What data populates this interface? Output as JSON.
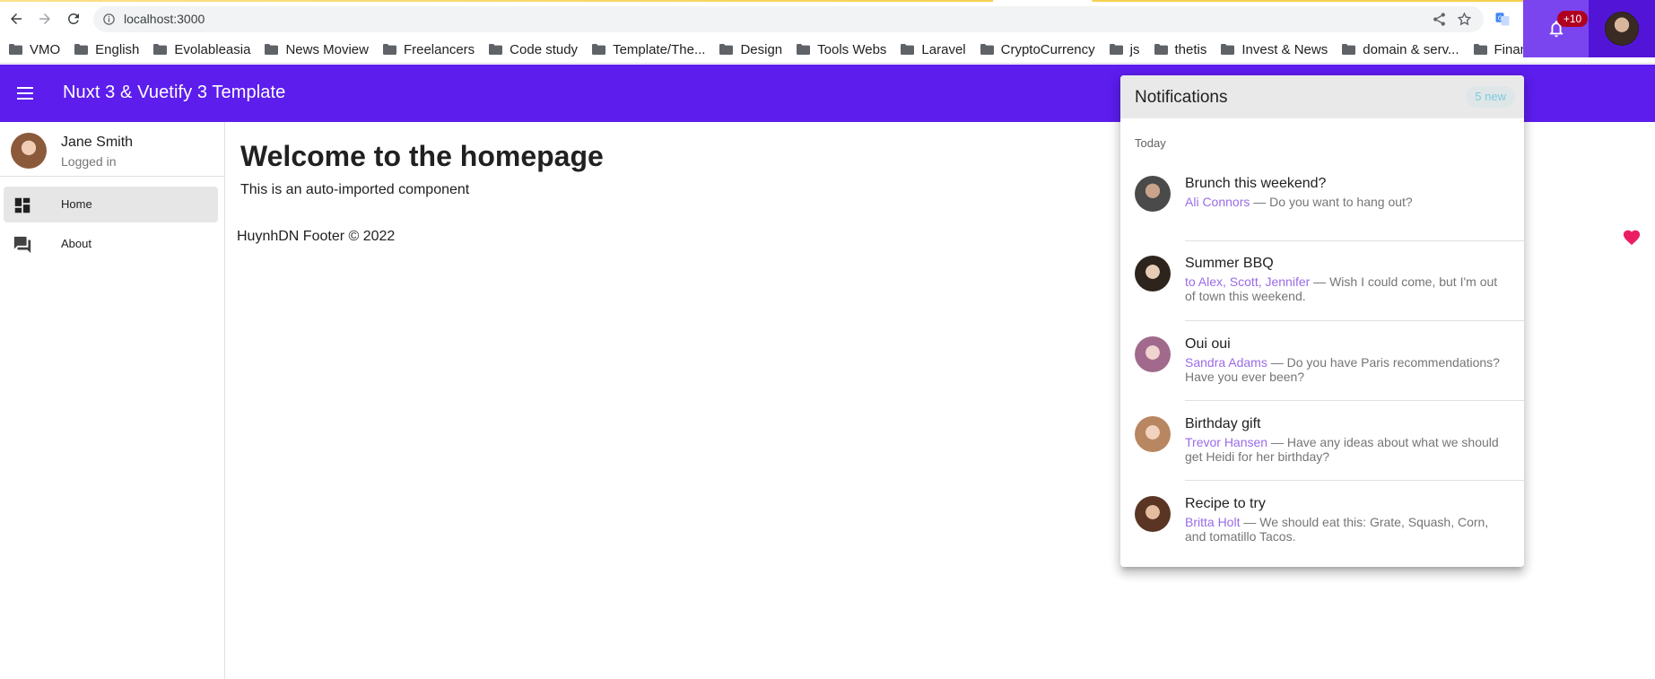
{
  "browser": {
    "url": "localhost:3000",
    "bookmarks": [
      "VMO",
      "English",
      "Evolableasia",
      "News Moview",
      "Freelancers",
      "Code study",
      "Template/The...",
      "Design",
      "Tools Webs",
      "Laravel",
      "CryptoCurrency",
      "js",
      "thetis",
      "Invest & News",
      "domain & serv...",
      "Financial"
    ],
    "bookmarks_more": "»"
  },
  "appbar": {
    "title": "Nuxt 3 & Vuetify 3 Template",
    "notification_badge": "+10"
  },
  "drawer": {
    "user_name": "Jane Smith",
    "user_status": "Logged in",
    "items": [
      {
        "label": "Home",
        "icon": "dashboard-icon",
        "active": true
      },
      {
        "label": "About",
        "icon": "forum-icon",
        "active": false
      }
    ]
  },
  "main": {
    "heading": "Welcome to the homepage",
    "subtext": "This is an auto-imported component",
    "footer": "HuynhDN Footer © 2022"
  },
  "notifications": {
    "title": "Notifications",
    "chip": "5 new",
    "subheader": "Today",
    "items": [
      {
        "title": "Brunch this weekend?",
        "from": "Ali Connors",
        "text": " — Do you want to hang out?"
      },
      {
        "title": "Summer BBQ",
        "from": "to Alex, Scott, Jennifer",
        "text": " — Wish I could come, but I'm out of town this weekend."
      },
      {
        "title": "Oui oui",
        "from": "Sandra Adams",
        "text": " — Do you have Paris recommendations? Have you ever been?"
      },
      {
        "title": "Birthday gift",
        "from": "Trevor Hansen",
        "text": " — Have any ideas about what we should get Heidi for her birthday?"
      },
      {
        "title": "Recipe to try",
        "from": "Britta Holt",
        "text": " — We should eat this: Grate, Squash, Corn, and tomatillo Tacos."
      }
    ]
  },
  "colors": {
    "primary": "#5c1ded",
    "badge": "#b00020",
    "accent_link": "#9a6be6",
    "heart": "#e91e63"
  }
}
